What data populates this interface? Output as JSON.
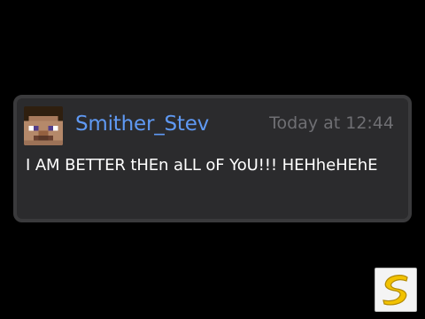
{
  "message": {
    "username": "Smither_Stev",
    "timestamp": "Today at 12:44",
    "text": "I AM BETTER tHEn aLL oF YoU!!! HEHheHEhE"
  },
  "icons": {
    "avatar": "minecraft-steve-avatar-icon",
    "logo": "yellow-s-logo-icon"
  },
  "colors": {
    "background": "#000000",
    "card": "#2b2b2d",
    "card_border": "#3a3a3c",
    "username": "#5f99f3",
    "timestamp": "#6f6f73",
    "text": "#ffffff",
    "logo_yellow": "#f2c200"
  }
}
